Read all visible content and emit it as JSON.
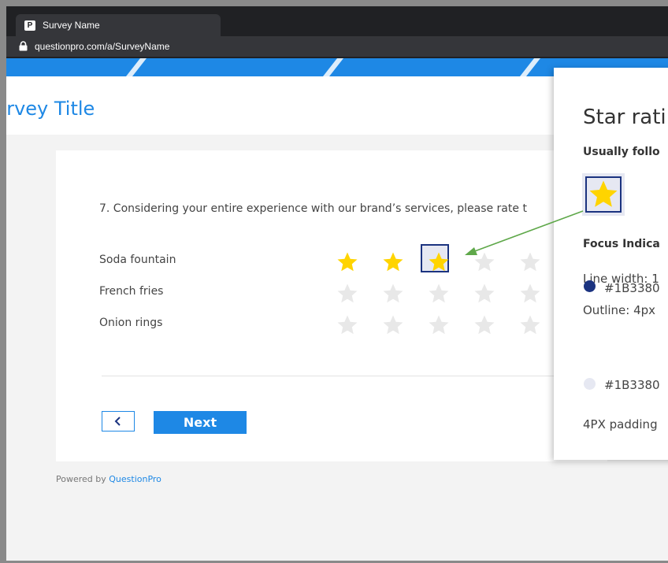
{
  "browser": {
    "tab_title": "Survey Name",
    "favicon_letter": "P",
    "url": "questionpro.com/a/SurveyName"
  },
  "survey": {
    "title": "urvey Title",
    "question": "7. Considering your entire experience with our brand’s services, please rate t",
    "rows": [
      {
        "label": "Soda fountain",
        "rating": 3,
        "max": 5
      },
      {
        "label": "French fries",
        "rating": 0,
        "max": 5
      },
      {
        "label": "Onion rings",
        "rating": 0,
        "max": 5
      }
    ],
    "back_icon": "chevron-left-icon",
    "next_label": "Next",
    "powered_prefix": "Powered by ",
    "powered_brand": "QuestionPro"
  },
  "panel": {
    "title": "Star rati",
    "subtitle": "Usually follo",
    "focus_heading": "Focus Indica",
    "line_width": "Line width: 1",
    "swatch1": "#1B3380",
    "outline": "Outline: 4px",
    "swatch2": "#1B3380",
    "padding": "4PX padding"
  },
  "colors": {
    "accent": "#1e88e5",
    "focus": "#1B3380",
    "star_filled": "#FFD400",
    "star_empty": "#e8e8e8",
    "arrow": "#5fa84a"
  }
}
